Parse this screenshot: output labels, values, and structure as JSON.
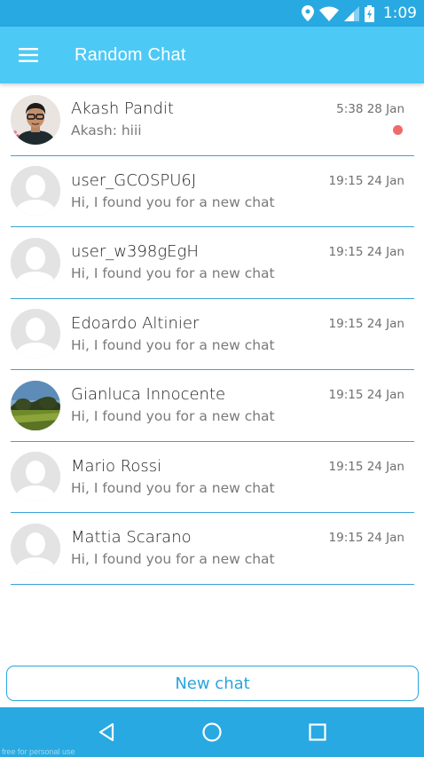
{
  "status_bar": {
    "time": "1:09"
  },
  "app_bar": {
    "title": "Random Chat",
    "menu_icon": "hamburger-menu-icon"
  },
  "chats": [
    {
      "name": "Akash Pandit",
      "preview": "Akash: hiii",
      "time": "5:38 28 Jan",
      "unread": true,
      "avatar": "photo-person"
    },
    {
      "name": "user_GCOSPU6J",
      "preview": "Hi, I found you for a new chat",
      "time": "19:15 24 Jan",
      "unread": false,
      "avatar": "placeholder"
    },
    {
      "name": "user_w398gEgH",
      "preview": "Hi, I found you for a new chat",
      "time": "19:15 24 Jan",
      "unread": false,
      "avatar": "placeholder"
    },
    {
      "name": "Edoardo Altinier",
      "preview": "Hi, I found you for a new chat",
      "time": "19:15 24 Jan",
      "unread": false,
      "avatar": "placeholder"
    },
    {
      "name": "Gianluca Innocente",
      "preview": "Hi, I found you for a new chat",
      "time": "19:15 24 Jan",
      "unread": false,
      "avatar": "photo-landscape"
    },
    {
      "name": "Mario Rossi",
      "preview": "Hi, I found you for a new chat",
      "time": "19:15 24 Jan",
      "unread": false,
      "avatar": "placeholder"
    },
    {
      "name": "Mattia Scarano",
      "preview": "Hi, I found you for a new chat",
      "time": "19:15 24 Jan",
      "unread": false,
      "avatar": "placeholder"
    }
  ],
  "new_chat_label": "New chat",
  "watermark": "free for personal use",
  "colors": {
    "status_bar": "#29a9e1",
    "app_bar": "#4dc9f6",
    "accent": "#2aa5dc",
    "unread": "#ef6b6b"
  }
}
